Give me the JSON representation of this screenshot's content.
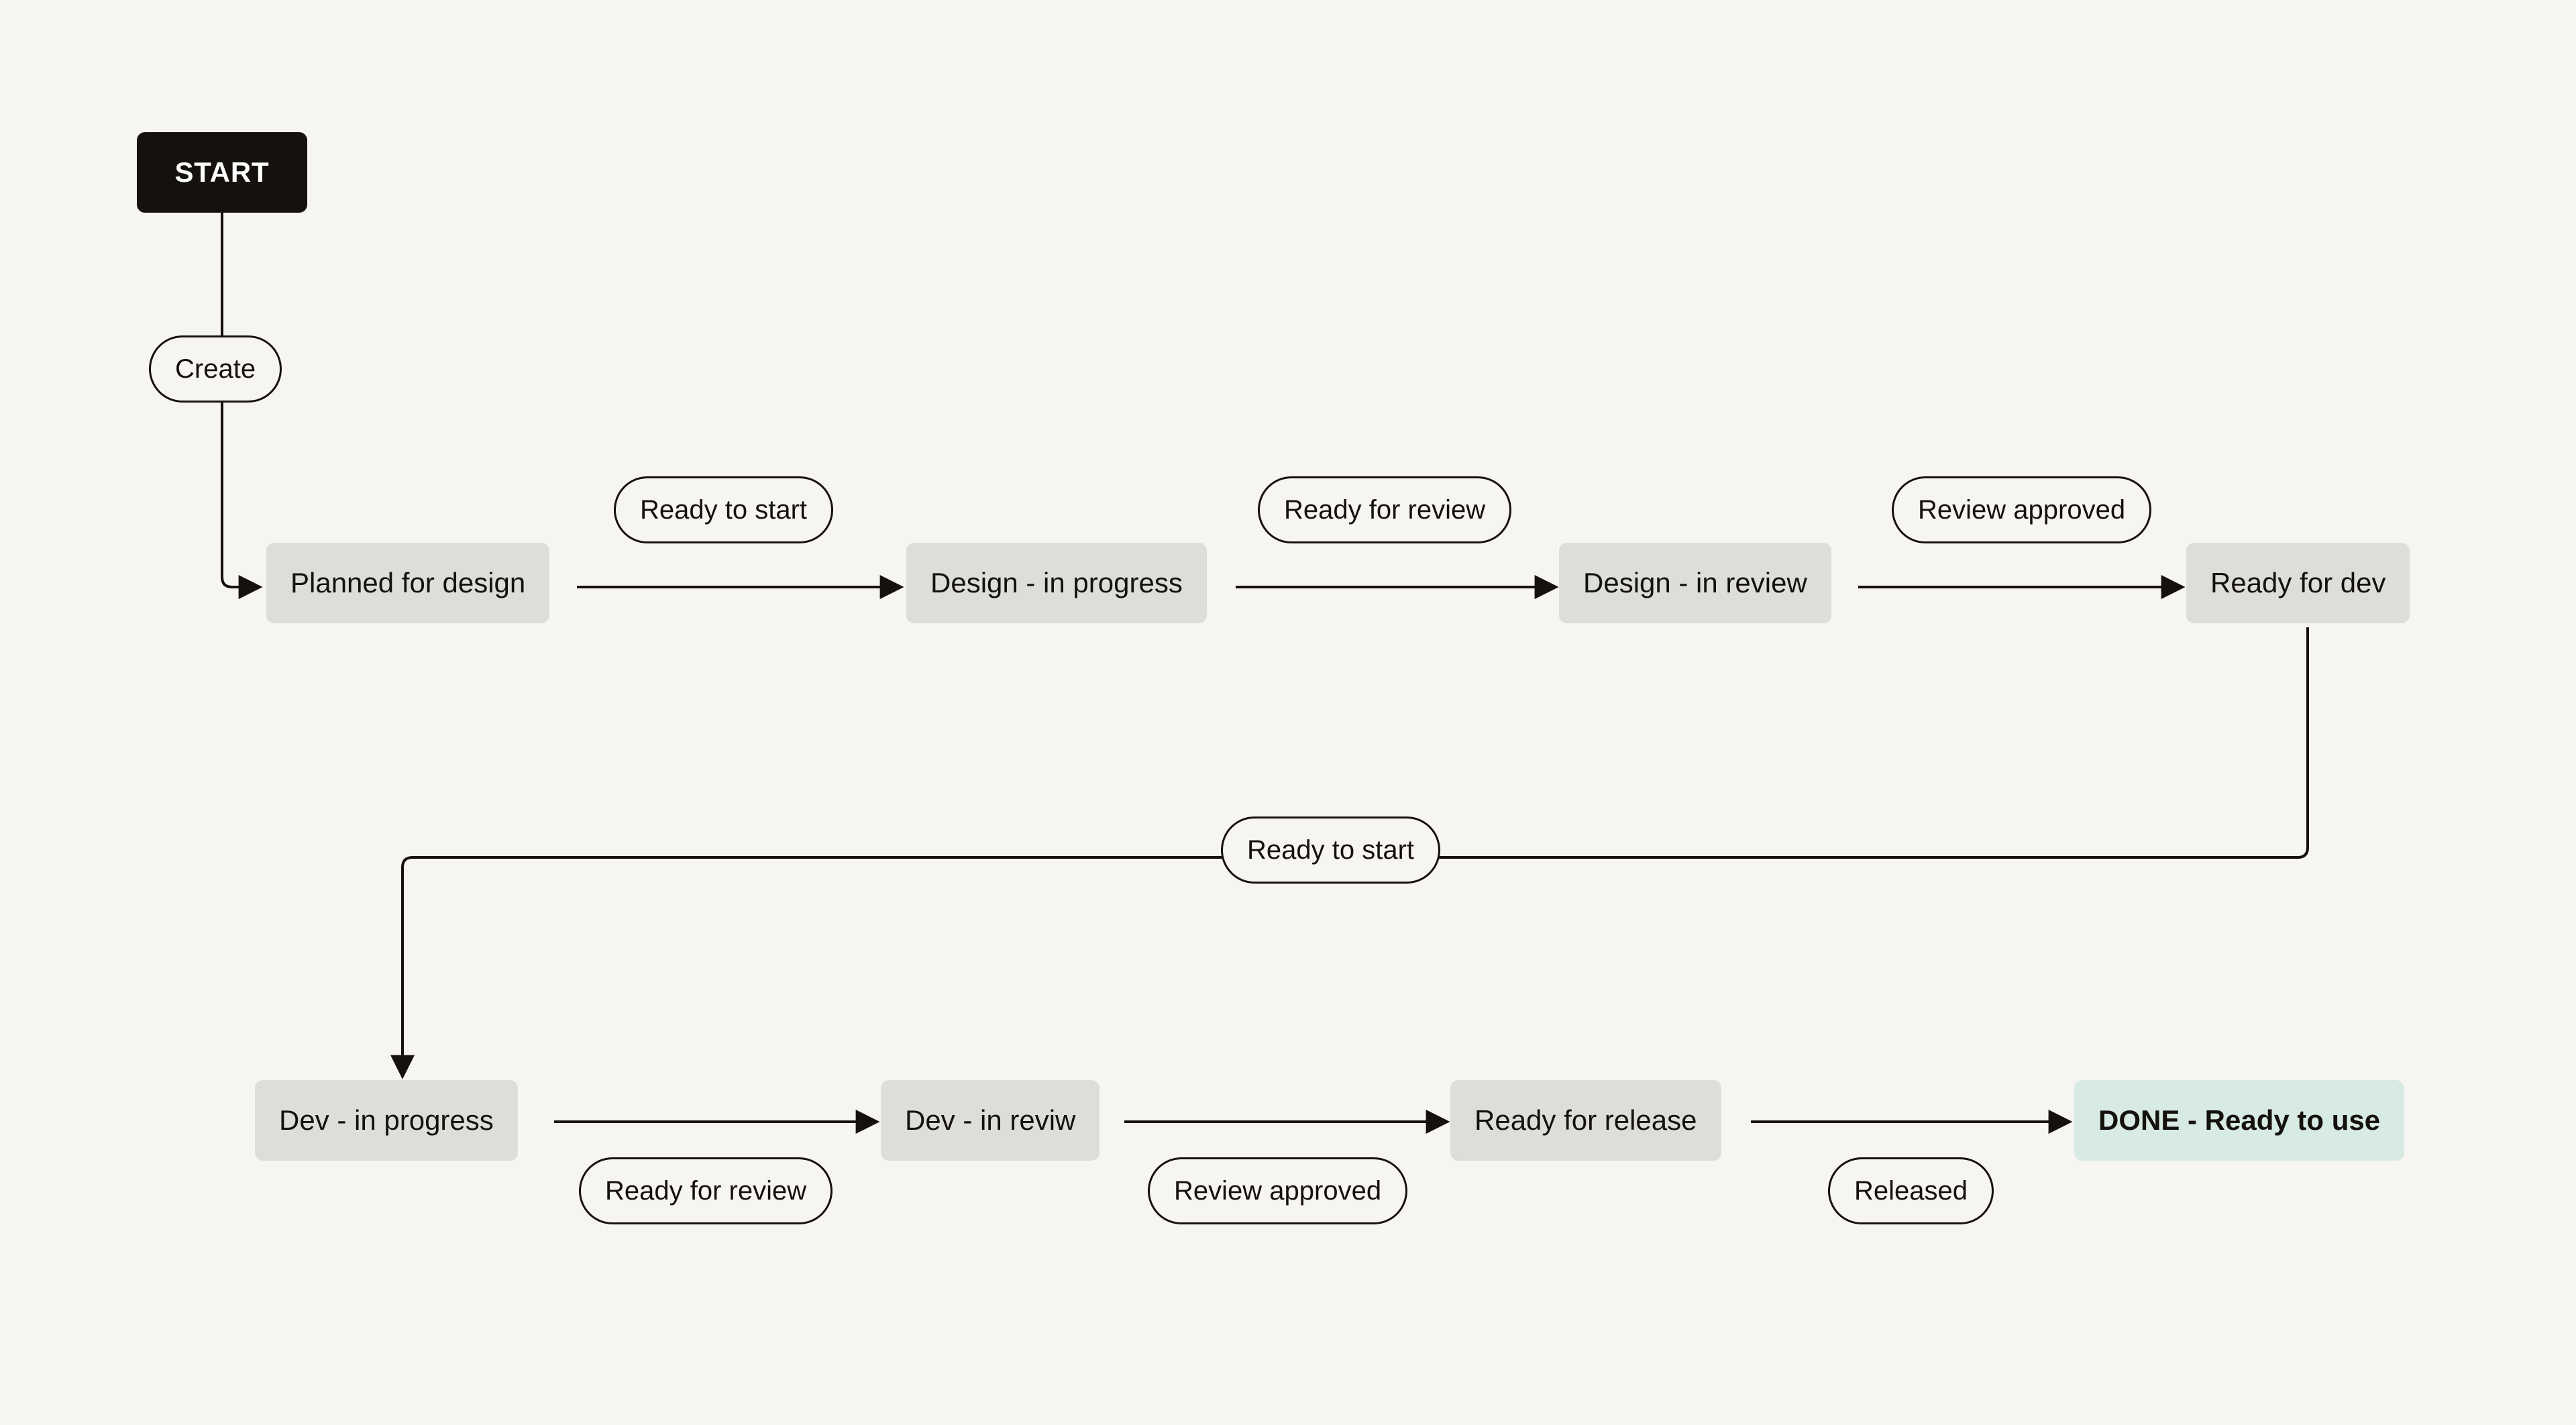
{
  "start": "START",
  "states": {
    "planned_for_design": "Planned for design",
    "design_in_progress": "Design - in progress",
    "design_in_review": "Design - in review",
    "ready_for_dev": "Ready for dev",
    "dev_in_progress": "Dev - in progress",
    "dev_in_review": "Dev - in reviw",
    "ready_for_release": "Ready for release",
    "done": "DONE - Ready to use"
  },
  "transitions": {
    "create": "Create",
    "ready_to_start_1": "Ready to start",
    "ready_for_review_1": "Ready for review",
    "review_approved_1": "Review approved",
    "ready_to_start_2": "Ready to start",
    "ready_for_review_2": "Ready for review",
    "review_approved_2": "Review approved",
    "released": "Released"
  }
}
